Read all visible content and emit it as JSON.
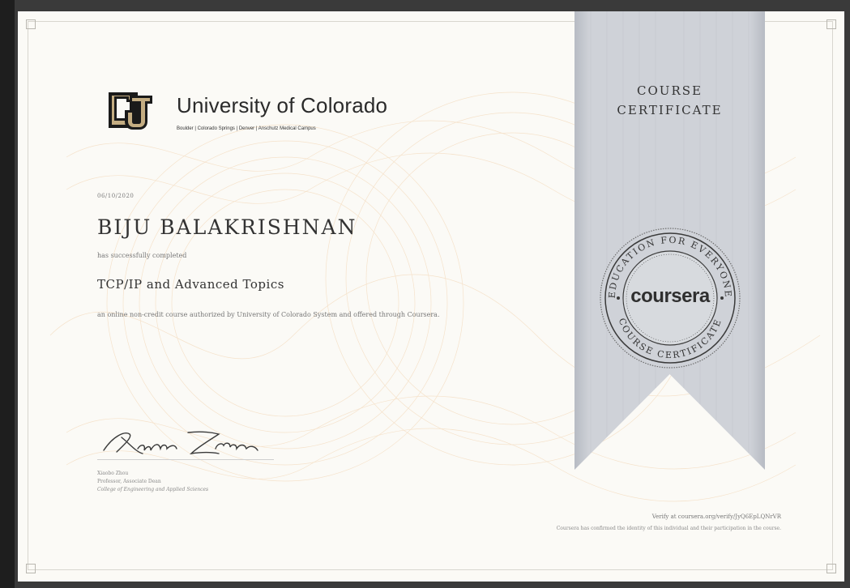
{
  "university": {
    "name": "University of Colorado",
    "campuses": "Boulder | Colorado Springs | Denver | Anschutz Medical Campus"
  },
  "certificate": {
    "date": "06/10/2020",
    "recipient": "BIJU BALAKRISHNAN",
    "completed_text": "has successfully completed",
    "course_title": "TCP/IP and Advanced Topics",
    "course_description": "an online non-credit course authorized by University of Colorado System and offered through Coursera."
  },
  "ribbon": {
    "title_line1": "COURSE",
    "title_line2": "CERTIFICATE"
  },
  "seal": {
    "brand": "coursera",
    "top_text": "EDUCATION FOR EVERYONE",
    "bottom_text": "COURSE CERTIFICATE"
  },
  "signer": {
    "signature_text": "Xiaobo Zhou",
    "name": "Xiaobo Zhou",
    "title": "Professor, Associate Dean",
    "department": "College of Engineering and Applied Sciences"
  },
  "verification": {
    "verify_text": "Verify at coursera.org/verify/JyQ6EpLQNrVR",
    "confirm_text": "Coursera has confirmed the identity of this individual and their participation in the course."
  },
  "colors": {
    "paper": "#fbfaf6",
    "ribbon": "#c9ccd2",
    "pattern": "#f1cfa8",
    "logo_gold": "#c4ad82",
    "logo_black": "#1a1a1a"
  },
  "icons": [
    "cu-logo-icon",
    "coursera-seal-icon"
  ]
}
